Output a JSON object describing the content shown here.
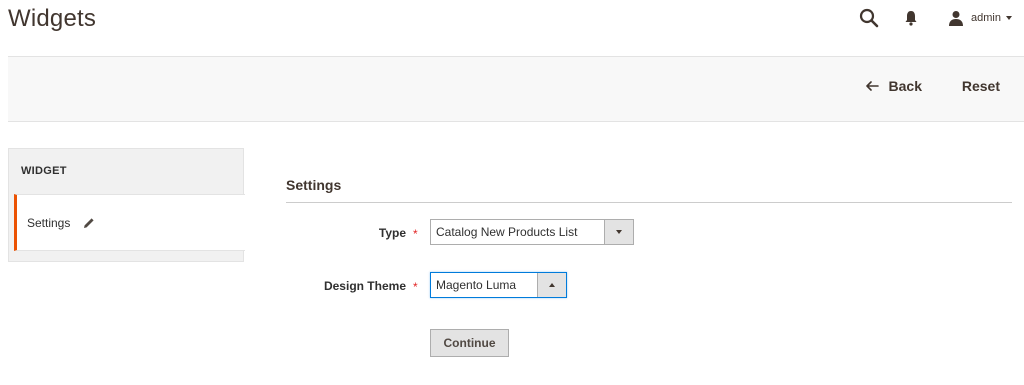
{
  "page": {
    "title": "Widgets"
  },
  "header": {
    "search_icon": "search-icon",
    "notifications_icon": "bell-icon",
    "user": {
      "icon": "user-icon",
      "name": "admin"
    }
  },
  "actions": {
    "back_label": "Back",
    "back_icon": "arrow-left-icon",
    "reset_label": "Reset"
  },
  "sidebar": {
    "title": "WIDGET",
    "items": [
      {
        "label": "Settings",
        "icon": "pencil-icon",
        "active": true
      }
    ]
  },
  "form": {
    "section_title": "Settings",
    "fields": {
      "type": {
        "label": "Type",
        "required_mark": "*",
        "value": "Catalog New Products List"
      },
      "design_theme": {
        "label": "Design Theme",
        "required_mark": "*",
        "value": "Magento Luma"
      }
    },
    "continue_label": "Continue"
  },
  "colors": {
    "accent": "#eb5202",
    "required": "#e22626",
    "focus_border": "#007bdb",
    "action_bar_bg": "#f8f8f8",
    "sidebar_bg": "#f1f1f1",
    "button_bg": "#e3e3e3"
  }
}
